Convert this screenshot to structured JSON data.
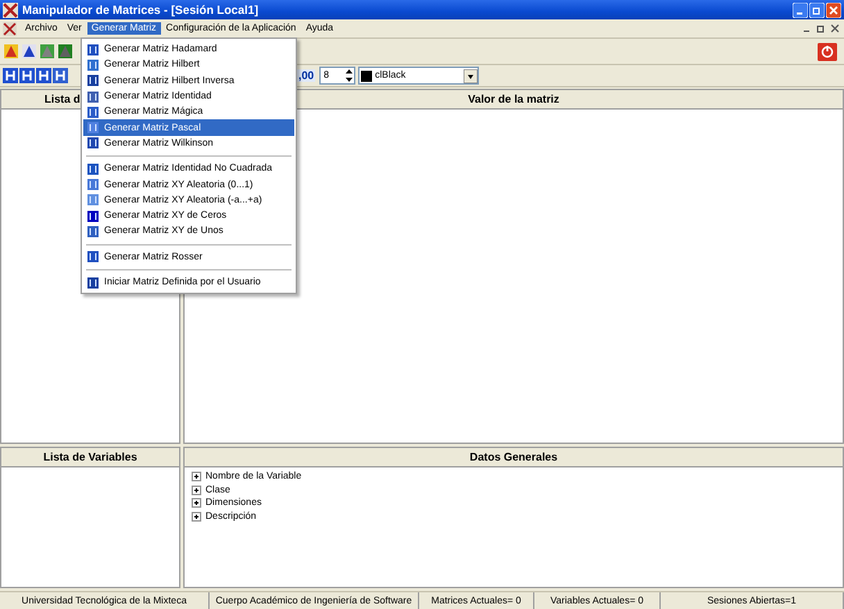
{
  "window": {
    "title": "Manipulador de Matrices - [Sesión Local1]"
  },
  "menu": [
    {
      "label": "Archivo",
      "selected": false
    },
    {
      "label": "Ver",
      "selected": false
    },
    {
      "label": "Generar Matriz",
      "selected": true
    },
    {
      "label": "Configuración de la Aplicación",
      "selected": false
    },
    {
      "label": "Ayuda",
      "selected": false
    }
  ],
  "dropdown": [
    {
      "kind": "item",
      "label": "Generar Matriz Hadamard",
      "selected": false
    },
    {
      "kind": "item",
      "label": "Generar Matriz Hilbert",
      "selected": false
    },
    {
      "kind": "item",
      "label": "Generar Matriz Hilbert Inversa",
      "selected": false
    },
    {
      "kind": "item",
      "label": "Generar Matriz Identidad",
      "selected": false
    },
    {
      "kind": "item",
      "label": "Generar Matriz Mágica",
      "selected": false
    },
    {
      "kind": "item",
      "label": "Generar Matriz Pascal",
      "selected": true
    },
    {
      "kind": "item",
      "label": "Generar Matriz Wilkinson",
      "selected": false
    },
    {
      "kind": "separator"
    },
    {
      "kind": "item",
      "label": "Generar Matriz Identidad No Cuadrada",
      "selected": false
    },
    {
      "kind": "item",
      "label": "Generar Matriz XY Aleatoria (0...1)",
      "selected": false
    },
    {
      "kind": "item",
      "label": "Generar Matriz XY Aleatoria (-a...+a)",
      "selected": false
    },
    {
      "kind": "item",
      "label": "Generar Matriz XY de Ceros",
      "selected": false
    },
    {
      "kind": "item",
      "label": "Generar Matriz XY de Unos",
      "selected": false
    },
    {
      "kind": "separator"
    },
    {
      "kind": "item",
      "label": "Generar Matriz Rosser",
      "selected": false
    },
    {
      "kind": "separator"
    },
    {
      "kind": "item",
      "label": "Iniciar Matriz Definida por el Usuario",
      "selected": false
    }
  ],
  "format_toolbar": {
    "decimals_label": ",00",
    "spin_value": "8",
    "color_name": "clBlack"
  },
  "matrix_list": {
    "header": "Lista d"
  },
  "matrix_value": {
    "header": "Valor de la matriz"
  },
  "variable_list": {
    "header": "Lista de Variables"
  },
  "general_data": {
    "header": "Datos Generales",
    "tree": [
      {
        "label": "Nombre de la Variable",
        "expanded": false
      },
      {
        "label": "Clase",
        "expanded": false
      },
      {
        "label": "Dimensiones",
        "expanded": false
      },
      {
        "label": "Descripción",
        "expanded": false
      }
    ]
  },
  "status_bar": [
    "Universidad Tecnológica de la Mixteca",
    "Cuerpo Académico de Ingeniería de Software",
    "Matrices Actuales= 0",
    "Variables Actuales= 0",
    "Sesiones Abiertas=1"
  ]
}
